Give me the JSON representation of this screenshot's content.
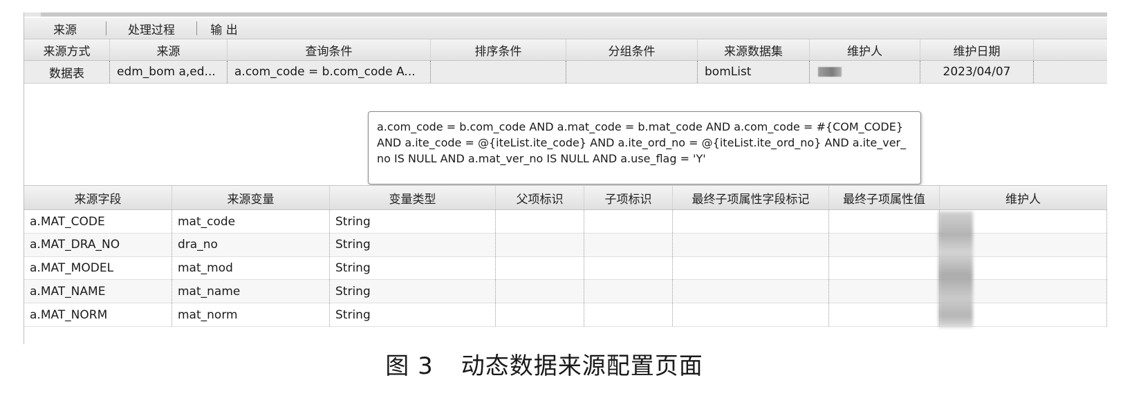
{
  "tabs": [
    "来源",
    "处理过程",
    "输 出"
  ],
  "source_table": {
    "headers": [
      "来源方式",
      "来源",
      "查询条件",
      "排序条件",
      "分组条件",
      "来源数据集",
      "维护人",
      "维护日期"
    ],
    "row": {
      "source_type": "数据表",
      "source": "edm_bom a,ed...",
      "query": "a.com_code = b.com_code A...",
      "sort": "",
      "group": "",
      "dataset": "bomList",
      "maintainer": "",
      "date": "2023/04/07"
    }
  },
  "tooltip": "a.com_code = b.com_code AND a.mat_code = b.mat_code AND a.com_code = #{COM_CODE} AND a.ite_code = @{iteList.ite_code} AND a.ite_ord_no = @{iteList.ite_ord_no} AND a.ite_ver_no IS NULL AND a.mat_ver_no IS NULL AND a.use_flag = 'Y'",
  "field_table": {
    "headers": [
      "来源字段",
      "来源变量",
      "变量类型",
      "父项标识",
      "子项标识",
      "最终子项属性字段标记",
      "最终子项属性值",
      "维护人"
    ],
    "rows": [
      [
        "a.MAT_CODE",
        "mat_code",
        "String",
        "",
        "",
        "",
        "",
        ""
      ],
      [
        "a.MAT_DRA_NO",
        "dra_no",
        "String",
        "",
        "",
        "",
        "",
        ""
      ],
      [
        "a.MAT_MODEL",
        "mat_mod",
        "String",
        "",
        "",
        "",
        "",
        ""
      ],
      [
        "a.MAT_NAME",
        "mat_name",
        "String",
        "",
        "",
        "",
        "",
        ""
      ],
      [
        "a.MAT_NORM",
        "mat_norm",
        "String",
        "",
        "",
        "",
        "",
        ""
      ]
    ]
  },
  "caption": {
    "number": "图 3",
    "text": "动态数据来源配置页面"
  }
}
